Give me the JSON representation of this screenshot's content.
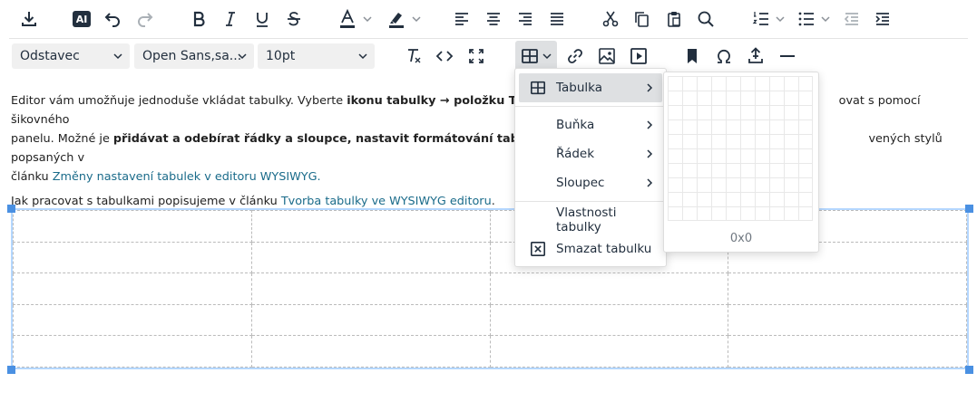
{
  "toolbar": {
    "block_format": "Odstavec",
    "font_family": "Open Sans,sa...",
    "font_size": "10pt",
    "ai_label": "AI"
  },
  "content": {
    "p1_a": "Editor vám umožňuje jednoduše vkládat tabulky. Vyberte ",
    "p1_b": "ikonu tabulky → položku Tabulk",
    "p1_c": "ovat s pomocí šikovného",
    "p1_d": "panelu. Možné je ",
    "p1_e": "přidávat a odebírat řádky a sloupce, nastavit formátování tabulky či j",
    "p1_f": "vených stylů popsaných v",
    "p1_g": "článku ",
    "p1_link": "Změny nastavení tabulek v editoru WYSIWYG.",
    "p2_a": "Jak pracovat s tabulkami popisujeme v článku ",
    "p2_link": "Tvorba tabulky ve WYSIWYG editoru",
    "p2_b": "."
  },
  "table_menu": {
    "items": [
      {
        "label": "Tabulka"
      },
      {
        "label": "Buňka"
      },
      {
        "label": "Řádek"
      },
      {
        "label": "Sloupec"
      },
      {
        "label": "Vlastnosti tabulky"
      },
      {
        "label": "Smazat tabulku"
      }
    ]
  },
  "grid_picker": {
    "size_label": "0x0"
  },
  "colors": {
    "accent": "#4a90e2",
    "link": "#1a6b8a",
    "hover": "#dee0e2",
    "icon": "#222f3e"
  }
}
